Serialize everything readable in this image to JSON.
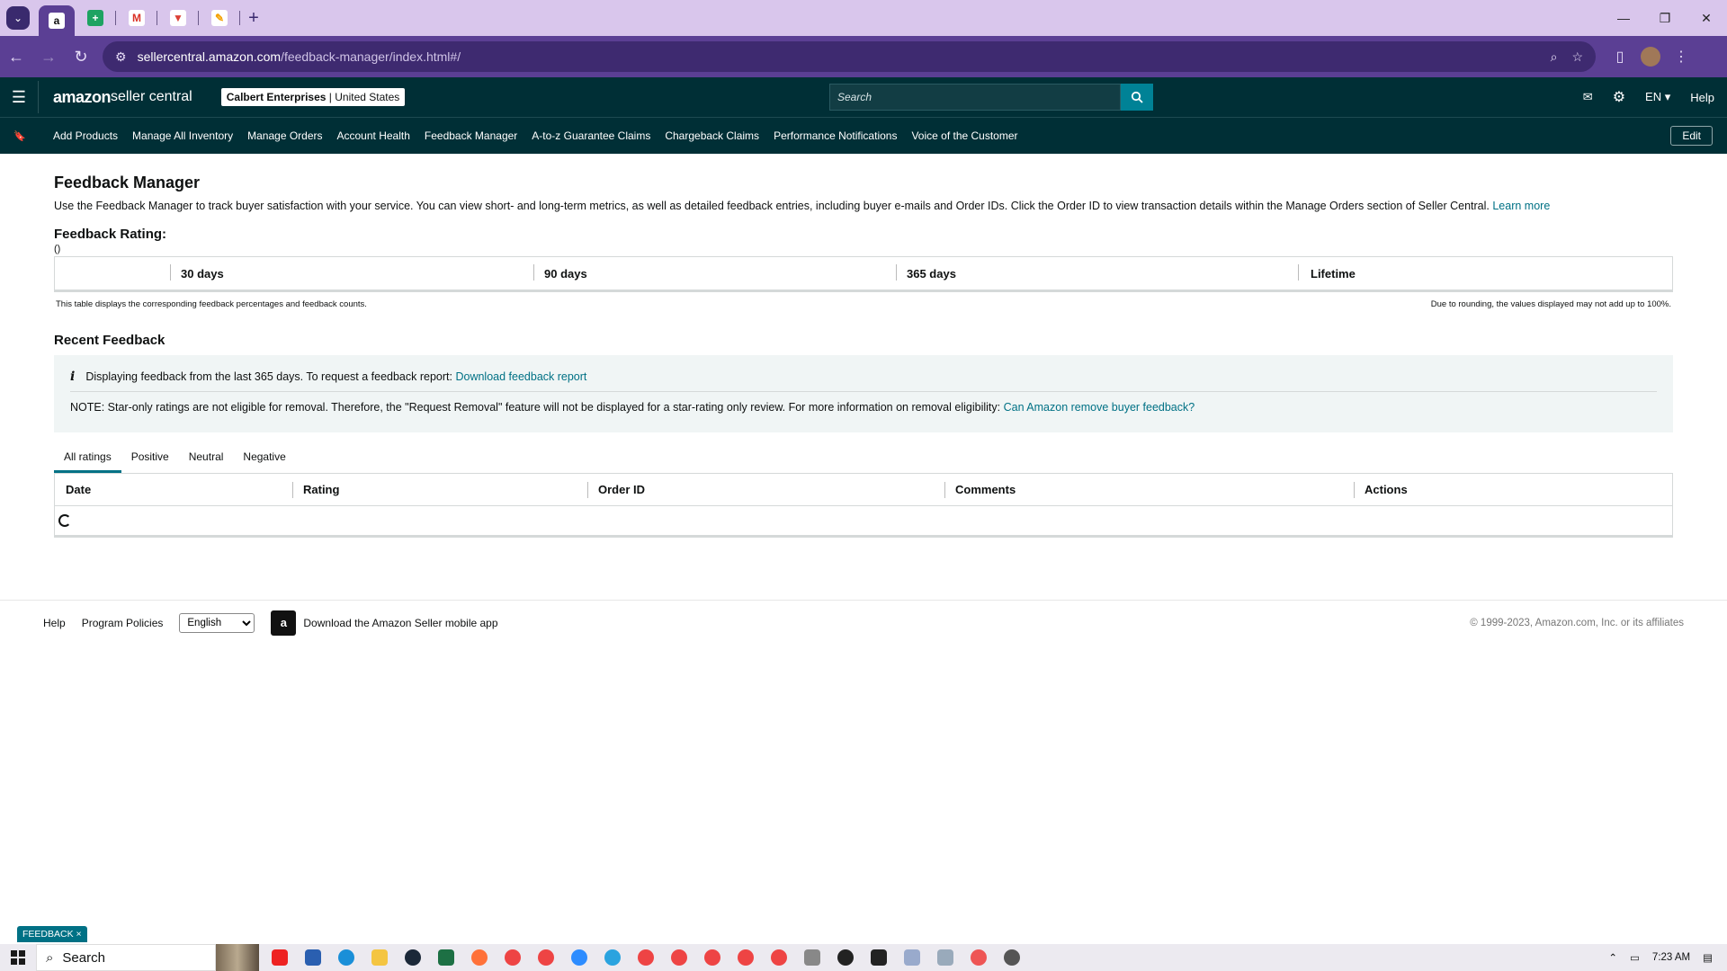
{
  "browser": {
    "url_host": "sellercentral.amazon.com",
    "url_path": "/feedback-manager/index.html#/",
    "tab_favicon": "a"
  },
  "header": {
    "logo_text_1": "amazon",
    "logo_text_2": " seller central",
    "account_name": "Calbert Enterprises",
    "account_region": "United States",
    "search_placeholder": "Search",
    "language": "EN",
    "help": "Help"
  },
  "nav": {
    "links": [
      "Add Products",
      "Manage All Inventory",
      "Manage Orders",
      "Account Health",
      "Feedback Manager",
      "A-to-z Guarantee Claims",
      "Chargeback Claims",
      "Performance Notifications",
      "Voice of the Customer"
    ],
    "edit": "Edit"
  },
  "page": {
    "title": "Feedback Manager",
    "intro": "Use the Feedback Manager to track buyer satisfaction with your service. You can view short- and long-term metrics, as well as detailed feedback entries, including buyer e-mails and Order IDs. Click the Order ID to view transaction details within the Manage Orders section of Seller Central.",
    "learn_more": "Learn more",
    "rating_title": "Feedback Rating:",
    "rating_value": "()",
    "rating_cols": [
      "30 days",
      "90 days",
      "365 days",
      "Lifetime"
    ],
    "note_left": "This table displays the corresponding feedback percentages and feedback counts.",
    "note_right": "Due to rounding, the values displayed may not add up to 100%.",
    "recent_title": "Recent Feedback",
    "alert_text": "Displaying feedback from the last 365 days. To request a feedback report:",
    "alert_link": "Download feedback report",
    "note_text": "NOTE: Star-only ratings are not eligible for removal. Therefore, the \"Request Removal\" feature will not be displayed for a star-rating only review. For more information on removal eligibility:",
    "note_link": "Can Amazon remove buyer feedback?",
    "tabs": [
      "All ratings",
      "Positive",
      "Neutral",
      "Negative"
    ],
    "columns": [
      "Date",
      "Rating",
      "Order ID",
      "Comments",
      "Actions"
    ]
  },
  "footer": {
    "help": "Help",
    "policies": "Program Policies",
    "language_selected": "English",
    "app_text": "Download the Amazon Seller mobile app",
    "copyright": "© 1999-2023, Amazon.com, Inc. or its affiliates",
    "feedback_tab": "FEEDBACK ×"
  },
  "taskbar": {
    "search": "Search",
    "time": "7:23 AM"
  },
  "colors": {
    "amazon_header": "#002f36",
    "link": "#007185",
    "browser_accent": "#5b3f94"
  }
}
